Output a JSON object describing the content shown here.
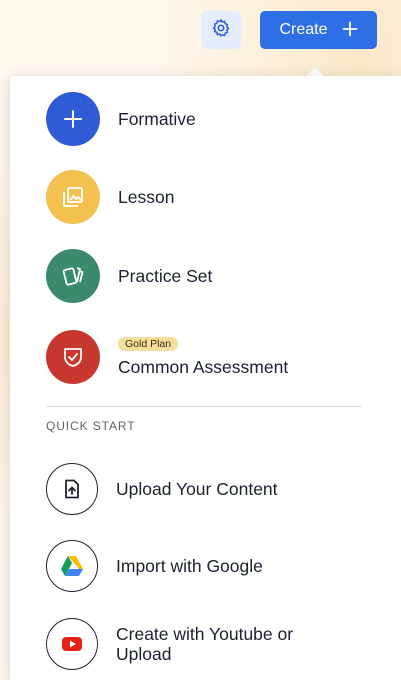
{
  "header": {
    "settings_icon": "gear-icon",
    "create_label": "Create",
    "create_icon": "plus-icon",
    "accent_color": "#2f6fe6"
  },
  "menu": {
    "items": [
      {
        "label": "Formative",
        "icon": "plus-icon",
        "color": "#2f5bd7"
      },
      {
        "label": "Lesson",
        "icon": "image-stack-icon",
        "color": "#f2c14e"
      },
      {
        "label": "Practice Set",
        "icon": "cards-icon",
        "color": "#3a8a6b"
      },
      {
        "label": "Common Assessment",
        "icon": "shield-check-icon",
        "color": "#c8372d",
        "badge": "Gold Plan"
      }
    ]
  },
  "quick_start": {
    "heading": "QUICK START",
    "items": [
      {
        "label": "Upload Your Content",
        "icon": "upload-file-icon"
      },
      {
        "label": "Import with Google",
        "icon": "google-drive-icon"
      },
      {
        "label": "Create with Youtube or Upload",
        "label_line1": "Create with Youtube or",
        "label_line2": "Upload",
        "icon": "youtube-icon"
      }
    ]
  }
}
